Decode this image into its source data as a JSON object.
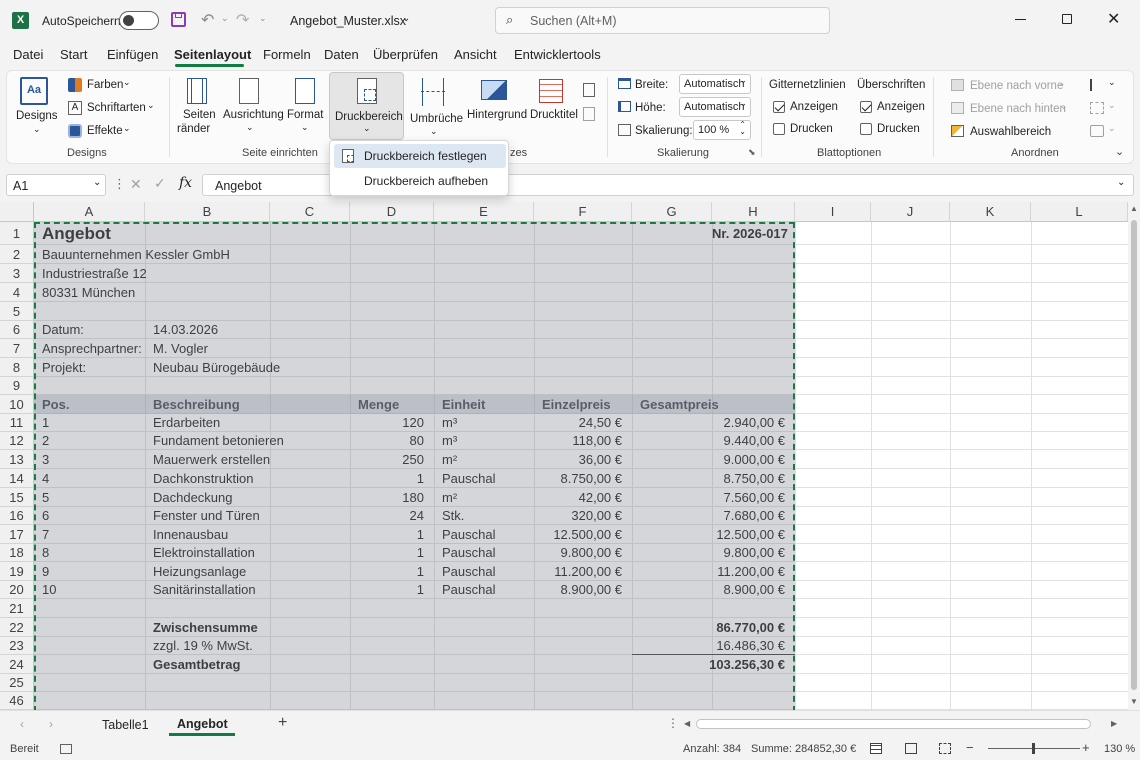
{
  "titlebar": {
    "autosave_label": "AutoSpeichern",
    "filename": "Angebot_Muster.xlsx",
    "search_placeholder": "Suchen (Alt+M)"
  },
  "menu": [
    "Datei",
    "Start",
    "Einfügen",
    "Seitenlayout",
    "Formeln",
    "Daten",
    "Überprüfen",
    "Ansicht",
    "Entwicklertools"
  ],
  "menu_active": "Seitenlayout",
  "ribbon": {
    "designs": {
      "designs": "Designs",
      "farben": "Farben",
      "schriftarten": "Schriftarten",
      "effekte": "Effekte",
      "group": "Designs"
    },
    "seite": {
      "seitenraender_1": "Seiten",
      "seitenraender_2": "ränder",
      "ausrichtung": "Ausrichtung",
      "format": "Format",
      "druckbereich": "Druckbereich",
      "umbrueche": "Umbrüche",
      "hintergrund": "Hintergrund",
      "drucktitel": "Drucktitel",
      "group": "Seite einrichten",
      "group_clip": "zes"
    },
    "skalierung": {
      "breite_label": "Breite:",
      "breite_value": "Automatisch",
      "hoehe_label": "Höhe:",
      "hoehe_value": "Automatisch",
      "skalierung_label": "Skalierung:",
      "skalierung_value": "100 %",
      "group": "Skalierung"
    },
    "blattoptionen": {
      "gitter": "Gitternetzlinien",
      "ueberschriften": "Überschriften",
      "anzeigen": "Anzeigen",
      "drucken": "Drucken",
      "group": "Blattoptionen"
    },
    "anordnen": {
      "vorne": "Ebene nach vorne",
      "hinten": "Ebene nach hinten",
      "auswahl": "Auswahlbereich",
      "group": "Anordnen"
    }
  },
  "dropdown": {
    "festlegen": "Druckbereich festlegen",
    "aufheben": "Druckbereich aufheben"
  },
  "formulabar": {
    "namebox": "A1",
    "content": "Angebot"
  },
  "columns": [
    "A",
    "B",
    "C",
    "D",
    "E",
    "F",
    "G",
    "H",
    "I",
    "J",
    "K",
    "L"
  ],
  "rows": [
    "1",
    "2",
    "3",
    "4",
    "5",
    "6",
    "7",
    "8",
    "9",
    "10",
    "11",
    "12",
    "13",
    "14",
    "15",
    "16",
    "17",
    "18",
    "19",
    "20",
    "21",
    "22",
    "23",
    "24",
    "25",
    "46"
  ],
  "sheet": {
    "title": "Angebot",
    "nr": "Nr. 2026-017",
    "company": "Bauunternehmen Kessler GmbH",
    "street": "Industriestraße 12",
    "city": "80331 München",
    "datum_label": "Datum:",
    "datum": "14.03.2026",
    "ansprech_label": "Ansprechpartner:",
    "ansprech": "M. Vogler",
    "projekt_label": "Projekt:",
    "projekt": "Neubau Bürogebäude",
    "headers": [
      "Pos.",
      "Beschreibung",
      "Menge",
      "Einheit",
      "Einzelpreis",
      "Gesamtpreis"
    ],
    "items": [
      [
        "1",
        "Erdarbeiten",
        "120",
        "m³",
        "24,50 €",
        "2.940,00 €"
      ],
      [
        "2",
        "Fundament betonieren",
        "80",
        "m³",
        "118,00 €",
        "9.440,00 €"
      ],
      [
        "3",
        "Mauerwerk erstellen",
        "250",
        "m²",
        "36,00 €",
        "9.000,00 €"
      ],
      [
        "4",
        "Dachkonstruktion",
        "1",
        "Pauschal",
        "8.750,00 €",
        "8.750,00 €"
      ],
      [
        "5",
        "Dachdeckung",
        "180",
        "m²",
        "42,00 €",
        "7.560,00 €"
      ],
      [
        "6",
        "Fenster und Türen",
        "24",
        "Stk.",
        "320,00 €",
        "7.680,00 €"
      ],
      [
        "7",
        "Innenausbau",
        "1",
        "Pauschal",
        "12.500,00 €",
        "12.500,00 €"
      ],
      [
        "8",
        "Elektroinstallation",
        "1",
        "Pauschal",
        "9.800,00 €",
        "9.800,00 €"
      ],
      [
        "9",
        "Heizungsanlage",
        "1",
        "Pauschal",
        "11.200,00 €",
        "11.200,00 €"
      ],
      [
        "10",
        "Sanitärinstallation",
        "1",
        "Pauschal",
        "8.900,00 €",
        "8.900,00 €"
      ]
    ],
    "zwischensumme_label": "Zwischensumme",
    "zwischensumme": "86.770,00 €",
    "mwst_label": "zzgl. 19 % MwSt.",
    "mwst": "16.486,30 €",
    "gesamt_label": "Gesamtbetrag",
    "gesamt": "103.256,30 €"
  },
  "tabs": [
    "Tabelle1",
    "Angebot"
  ],
  "active_tab": "Angebot",
  "status": {
    "bereit": "Bereit",
    "anzahl": "Anzahl: 384",
    "summe": "Summe: 284852,30 €",
    "zoom": "130 %"
  },
  "colors": {
    "accent_green": "#107c41",
    "print_border": "#1b7a43",
    "excel_icon": "#1e7145"
  }
}
